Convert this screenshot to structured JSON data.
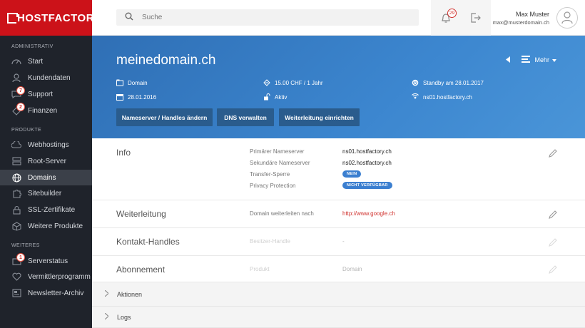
{
  "brand": {
    "logo_text": "HOSTFACTORY",
    "color": "#cc1219"
  },
  "sidebar": {
    "sections": [
      "ADMINISTRATIV",
      "PRODUKTE",
      "WEITERES"
    ],
    "admin_items": [
      {
        "label": "Start",
        "icon": "speedometer-icon"
      },
      {
        "label": "Kundendaten",
        "icon": "user-icon"
      },
      {
        "label": "Support",
        "icon": "chat-icon",
        "badge": "7"
      },
      {
        "label": "Finanzen",
        "icon": "tag-icon",
        "badge": "2"
      }
    ],
    "product_items": [
      {
        "label": "Webhostings",
        "icon": "cloud-icon"
      },
      {
        "label": "Root-Server",
        "icon": "server-icon"
      },
      {
        "label": "Domains",
        "icon": "globe-icon",
        "active": true
      },
      {
        "label": "Sitebuilder",
        "icon": "puzzle-icon"
      },
      {
        "label": "SSL-Zertifikate",
        "icon": "lock-icon"
      },
      {
        "label": "Weitere Produkte",
        "icon": "box-icon"
      }
    ],
    "more_items": [
      {
        "label": "Serverstatus",
        "icon": "status-icon",
        "badge": "1"
      },
      {
        "label": "Vermittlerprogramm",
        "icon": "heart-icon"
      },
      {
        "label": "Newsletter-Archiv",
        "icon": "newsletter-icon"
      }
    ]
  },
  "topbar": {
    "search_placeholder": "Suche",
    "notifications": "29",
    "user_name": "Max Muster",
    "user_email": "max@musterdomain.ch"
  },
  "hero": {
    "title": "meinedomain.ch",
    "more_label": "Mehr",
    "type": "Domain",
    "price": "15.00 CHF / 1 Jahr",
    "standby": "Standby am 28.01.2017",
    "date": "28.01.2016",
    "status": "Aktiv",
    "nameserver": "ns01.hostfactory.ch",
    "buttons": [
      "Nameserver / Handles ändern",
      "DNS verwalten",
      "Weiterleitung einrichten"
    ]
  },
  "sections": {
    "info": {
      "title": "Info",
      "primary_ns_label": "Primärer Nameserver",
      "primary_ns": "ns01.hostfactory.ch",
      "secondary_ns_label": "Sekundäre Nameserver",
      "secondary_ns": "ns02.hostfactory.ch",
      "transfer_label": "Transfer-Sperre",
      "transfer_value": "NEIN",
      "privacy_label": "Privacy Protection",
      "privacy_value": "NICHT VERFÜGBAR"
    },
    "forward": {
      "title": "Weiterleitung",
      "label": "Domain weiterleiten nach",
      "value": "http://www.google.ch"
    },
    "contact": {
      "title": "Kontakt-Handles",
      "label": "Besitzer-Handle",
      "value": "-"
    },
    "subscription": {
      "title": "Abonnement",
      "label": "Produkt",
      "value": "Domain"
    }
  },
  "collapsibles": [
    "Aktionen",
    "Logs"
  ],
  "colors": {
    "hero": "#3c86cf",
    "link_red": "#d0312d",
    "pill": "#3b7fd0",
    "button": "#2a5c8d"
  }
}
